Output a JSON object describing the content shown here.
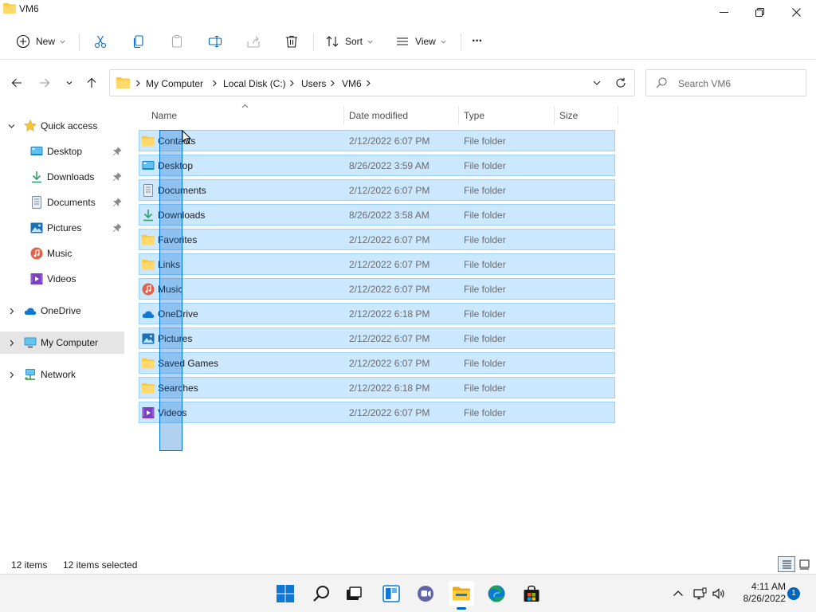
{
  "window": {
    "title": "VM6"
  },
  "toolbar": {
    "new_label": "New",
    "sort_label": "Sort",
    "view_label": "View",
    "more_label": "···"
  },
  "address": {
    "crumbs": [
      "My Computer",
      "Local Disk (C:)",
      "Users",
      "VM6"
    ]
  },
  "search": {
    "placeholder": "Search VM6"
  },
  "sidebar": {
    "items": [
      {
        "label": "Quick access",
        "icon": "star-icon"
      },
      {
        "label": "Desktop",
        "icon": "desktop-icon",
        "pinned": true
      },
      {
        "label": "Downloads",
        "icon": "download-icon",
        "pinned": true
      },
      {
        "label": "Documents",
        "icon": "documents-icon",
        "pinned": true
      },
      {
        "label": "Pictures",
        "icon": "pictures-icon",
        "pinned": true
      },
      {
        "label": "Music",
        "icon": "music-icon"
      },
      {
        "label": "Videos",
        "icon": "videos-icon"
      },
      {
        "label": "OneDrive",
        "icon": "cloud-icon"
      },
      {
        "label": "My Computer",
        "icon": "computer-icon",
        "selected": true
      },
      {
        "label": "Network",
        "icon": "network-icon"
      }
    ]
  },
  "columns": {
    "name": "Name",
    "date": "Date modified",
    "type": "Type",
    "size": "Size"
  },
  "files": [
    {
      "name": "Contacts",
      "date": "2/12/2022 6:07 PM",
      "type": "File folder"
    },
    {
      "name": "Desktop",
      "date": "8/26/2022 3:59 AM",
      "type": "File folder"
    },
    {
      "name": "Documents",
      "date": "2/12/2022 6:07 PM",
      "type": "File folder"
    },
    {
      "name": "Downloads",
      "date": "8/26/2022 3:58 AM",
      "type": "File folder"
    },
    {
      "name": "Favorites",
      "date": "2/12/2022 6:07 PM",
      "type": "File folder"
    },
    {
      "name": "Links",
      "date": "2/12/2022 6:07 PM",
      "type": "File folder"
    },
    {
      "name": "Music",
      "date": "2/12/2022 6:07 PM",
      "type": "File folder"
    },
    {
      "name": "OneDrive",
      "date": "2/12/2022 6:18 PM",
      "type": "File folder"
    },
    {
      "name": "Pictures",
      "date": "2/12/2022 6:07 PM",
      "type": "File folder"
    },
    {
      "name": "Saved Games",
      "date": "2/12/2022 6:07 PM",
      "type": "File folder"
    },
    {
      "name": "Searches",
      "date": "2/12/2022 6:18 PM",
      "type": "File folder"
    },
    {
      "name": "Videos",
      "date": "2/12/2022 6:07 PM",
      "type": "File folder"
    }
  ],
  "status": {
    "count": "12 items",
    "selected": "12 items selected"
  },
  "taskbar": {
    "time": "4:11 AM",
    "date": "8/26/2022",
    "notifications": "1"
  },
  "colors": {
    "selection": "#cce8ff",
    "selection_border": "#99d1ff",
    "accent": "#0067c0",
    "folder": "#ffc83d"
  }
}
